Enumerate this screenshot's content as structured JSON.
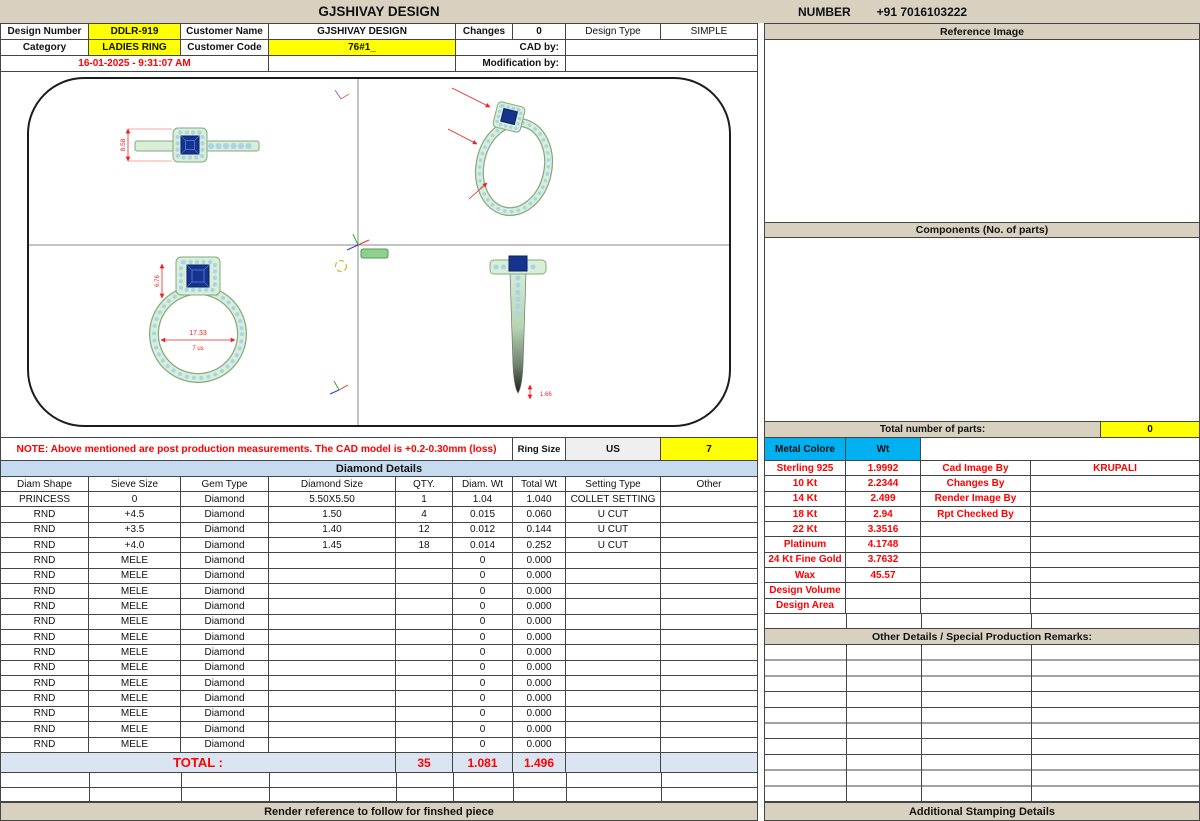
{
  "colors": {
    "header_tan": "#d8d1c0",
    "highlight_yellow": "#ffff00",
    "accent_cyan": "#00b0f0",
    "accent_red": "#ff0000",
    "table_title_blue": "#c6dbf0",
    "total_row_blue": "#dbe5f1"
  },
  "top_bar": {
    "title": "GJSHIVAY DESIGN",
    "number_label": "NUMBER",
    "phone": "+91 7016103222"
  },
  "info": {
    "design_number_label": "Design Number",
    "design_number": "DDLR-919",
    "customer_name_label": "Customer Name",
    "customer_name": "GJSHIVAY DESIGN",
    "changes_label": "Changes",
    "changes_value": "0",
    "design_type_label": "Design Type",
    "design_type_value": "SIMPLE",
    "category_label": "Category",
    "category_value": "LADIES RING",
    "customer_code_label": "Customer Code",
    "customer_code_value": "76#1_",
    "cad_by_label": "CAD by:",
    "modification_by_label": "Modification by:",
    "timestamp": "16-01-2025 - 9:31:07 AM"
  },
  "cad": {
    "dims": {
      "side_height": "8.58",
      "front_height": "6.76",
      "inner_diameter": "17.33",
      "ring_size": "7 us",
      "shank_thickness": "1.66"
    }
  },
  "note": {
    "text": "NOTE: Above mentioned are post production measurements. The CAD model is +0.2-0.30mm (loss)",
    "ring_size_label": "Ring Size",
    "ring_size_region": "US",
    "ring_size_value": "7"
  },
  "diamond": {
    "title": "Diamond Details",
    "headers": [
      "Diam Shape",
      "Sieve Size",
      "Gem Type",
      "Diamond Size",
      "QTY.",
      "Diam. Wt",
      "Total Wt",
      "Setting Type",
      "Other"
    ],
    "rows": [
      [
        "PRINCESS",
        "0",
        "Diamond",
        "5.50X5.50",
        "1",
        "1.04",
        "1.040",
        "COLLET SETTING",
        ""
      ],
      [
        "RND",
        "+4.5",
        "Diamond",
        "1.50",
        "4",
        "0.015",
        "0.060",
        "U CUT",
        ""
      ],
      [
        "RND",
        "+3.5",
        "Diamond",
        "1.40",
        "12",
        "0.012",
        "0.144",
        "U CUT",
        ""
      ],
      [
        "RND",
        "+4.0",
        "Diamond",
        "1.45",
        "18",
        "0.014",
        "0.252",
        "U CUT",
        ""
      ],
      [
        "RND",
        "MELE",
        "Diamond",
        "",
        "",
        "0",
        "0.000",
        "",
        ""
      ],
      [
        "RND",
        "MELE",
        "Diamond",
        "",
        "",
        "0",
        "0.000",
        "",
        ""
      ],
      [
        "RND",
        "MELE",
        "Diamond",
        "",
        "",
        "0",
        "0.000",
        "",
        ""
      ],
      [
        "RND",
        "MELE",
        "Diamond",
        "",
        "",
        "0",
        "0.000",
        "",
        ""
      ],
      [
        "RND",
        "MELE",
        "Diamond",
        "",
        "",
        "0",
        "0.000",
        "",
        ""
      ],
      [
        "RND",
        "MELE",
        "Diamond",
        "",
        "",
        "0",
        "0.000",
        "",
        ""
      ],
      [
        "RND",
        "MELE",
        "Diamond",
        "",
        "",
        "0",
        "0.000",
        "",
        ""
      ],
      [
        "RND",
        "MELE",
        "Diamond",
        "",
        "",
        "0",
        "0.000",
        "",
        ""
      ],
      [
        "RND",
        "MELE",
        "Diamond",
        "",
        "",
        "0",
        "0.000",
        "",
        ""
      ],
      [
        "RND",
        "MELE",
        "Diamond",
        "",
        "",
        "0",
        "0.000",
        "",
        ""
      ],
      [
        "RND",
        "MELE",
        "Diamond",
        "",
        "",
        "0",
        "0.000",
        "",
        ""
      ],
      [
        "RND",
        "MELE",
        "Diamond",
        "",
        "",
        "0",
        "0.000",
        "",
        ""
      ],
      [
        "RND",
        "MELE",
        "Diamond",
        "",
        "",
        "0",
        "0.000",
        "",
        ""
      ]
    ],
    "total_label": "TOTAL :",
    "total_qty": "35",
    "total_diam_wt": "1.081",
    "total_wt": "1.496"
  },
  "right_panel": {
    "reference_image_title": "Reference Image",
    "components_title": "Components (No. of parts)",
    "total_parts_label": "Total number of parts:",
    "total_parts_value": "0",
    "metal_color_header": "Metal Colore",
    "wt_header": "Wt",
    "metal_rows": [
      [
        "Sterling 925",
        "1.9992",
        "Cad Image By",
        "KRUPALI"
      ],
      [
        "10 Kt",
        "2.2344",
        "Changes By",
        ""
      ],
      [
        "14 Kt",
        "2.499",
        "Render Image By",
        ""
      ],
      [
        "18 Kt",
        "2.94",
        "Rpt Checked By",
        ""
      ],
      [
        "22 Kt",
        "3.3516",
        "",
        ""
      ],
      [
        "Platinum",
        "4.1748",
        "",
        ""
      ],
      [
        "24 Kt Fine Gold",
        "3.7632",
        "",
        ""
      ],
      [
        "Wax",
        "45.57",
        "",
        ""
      ],
      [
        "Design Volume",
        "",
        "",
        ""
      ],
      [
        "Design Area",
        "",
        "",
        ""
      ]
    ],
    "other_details_title": "Other Details / Special Production Remarks:",
    "stamping_title": "Additional Stamping Details"
  },
  "footer": {
    "render_note": "Render reference to follow for finshed piece"
  }
}
